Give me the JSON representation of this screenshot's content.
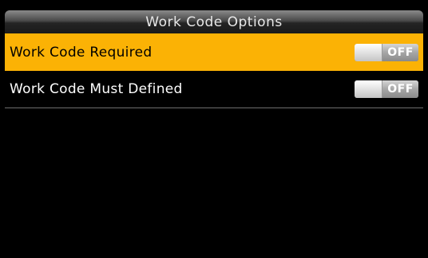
{
  "header": {
    "title": "Work Code Options"
  },
  "options": [
    {
      "label": "Work Code Required",
      "toggle_state": "OFF",
      "selected": true
    },
    {
      "label": "Work Code Must Defined",
      "toggle_state": "OFF",
      "selected": false
    }
  ],
  "colors": {
    "highlight": "#fbb205",
    "background": "#000000",
    "toggle_off": "#a6a6a6"
  }
}
